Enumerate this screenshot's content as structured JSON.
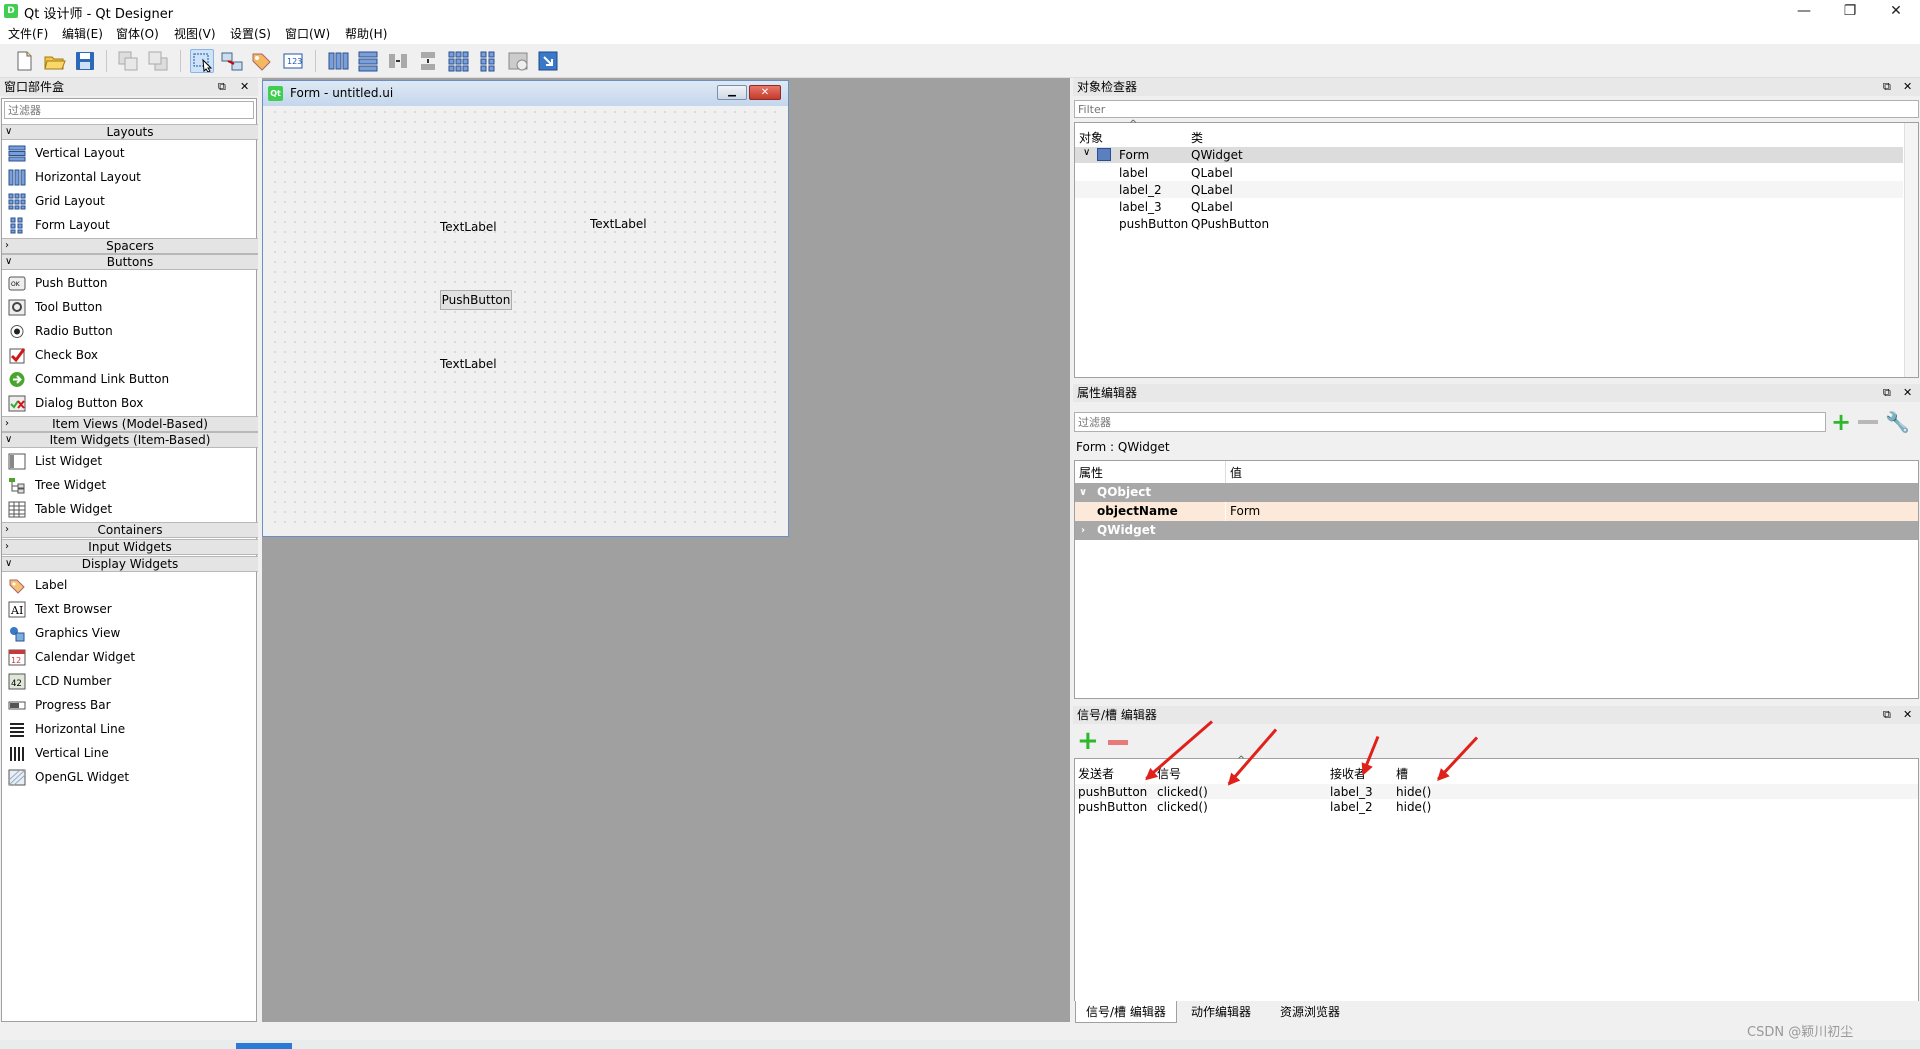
{
  "window": {
    "title": "Qt 设计师 - Qt Designer",
    "app_icon": "D",
    "minimize": "—",
    "restore": "❐",
    "close": "✕"
  },
  "menu": [
    "文件(F)",
    "编辑(E)",
    "窗体(O)",
    "视图(V)",
    "设置(S)",
    "窗口(W)",
    "帮助(H)"
  ],
  "widget_box": {
    "title": "窗口部件盒",
    "filter_placeholder": "过滤器",
    "categories": {
      "layouts": "Layouts",
      "spacers": "Spacers",
      "buttons": "Buttons",
      "item_views": "Item Views (Model-Based)",
      "item_widgets": "Item Widgets (Item-Based)",
      "containers": "Containers",
      "input_widgets": "Input Widgets",
      "display_widgets": "Display Widgets"
    },
    "layouts": [
      "Vertical Layout",
      "Horizontal Layout",
      "Grid Layout",
      "Form Layout"
    ],
    "buttons": [
      "Push Button",
      "Tool Button",
      "Radio Button",
      "Check Box",
      "Command Link Button",
      "Dialog Button Box"
    ],
    "item_widgets": [
      "List Widget",
      "Tree Widget",
      "Table Widget"
    ],
    "display_widgets": [
      "Label",
      "Text Browser",
      "Graphics View",
      "Calendar Widget",
      "LCD Number",
      "Progress Bar",
      "Horizontal Line",
      "Vertical Line",
      "OpenGL Widget"
    ]
  },
  "form": {
    "title": "Form - untitled.ui",
    "icon": "Qt",
    "label1": "TextLabel",
    "label2": "TextLabel",
    "label3": "TextLabel",
    "button": "PushButton"
  },
  "object_inspector": {
    "title": "对象检查器",
    "filter_placeholder": "Filter",
    "col_object": "对象",
    "col_class": "类",
    "rows": [
      {
        "name": "Form",
        "cls": "QWidget"
      },
      {
        "name": "label",
        "cls": "QLabel"
      },
      {
        "name": "label_2",
        "cls": "QLabel"
      },
      {
        "name": "label_3",
        "cls": "QLabel"
      },
      {
        "name": "pushButton",
        "cls": "QPushButton"
      }
    ]
  },
  "property_editor": {
    "title": "属性编辑器",
    "filter_placeholder": "过滤器",
    "context": "Form : QWidget",
    "col_property": "属性",
    "col_value": "值",
    "group_qobject": "QObject",
    "prop_name": "objectName",
    "prop_value": "Form",
    "group_qwidget": "QWidget"
  },
  "signal_slot_editor": {
    "title": "信号/槽 编辑器",
    "col_sender": "发送者",
    "col_signal": "信号",
    "col_receiver": "接收者",
    "col_slot": "槽",
    "rows": [
      {
        "sender": "pushButton",
        "signal": "clicked()",
        "receiver": "label_3",
        "slot": "hide()"
      },
      {
        "sender": "pushButton",
        "signal": "clicked()",
        "receiver": "label_2",
        "slot": "hide()"
      }
    ]
  },
  "bottom_tabs": [
    "信号/槽 编辑器",
    "动作编辑器",
    "资源浏览器"
  ],
  "watermark": "CSDN @颖川初尘",
  "colors": {
    "accent": "#41cd52",
    "annotation": "#e0201a",
    "group_header": "#a8a8a8",
    "selected_row": "#fde9d9"
  }
}
